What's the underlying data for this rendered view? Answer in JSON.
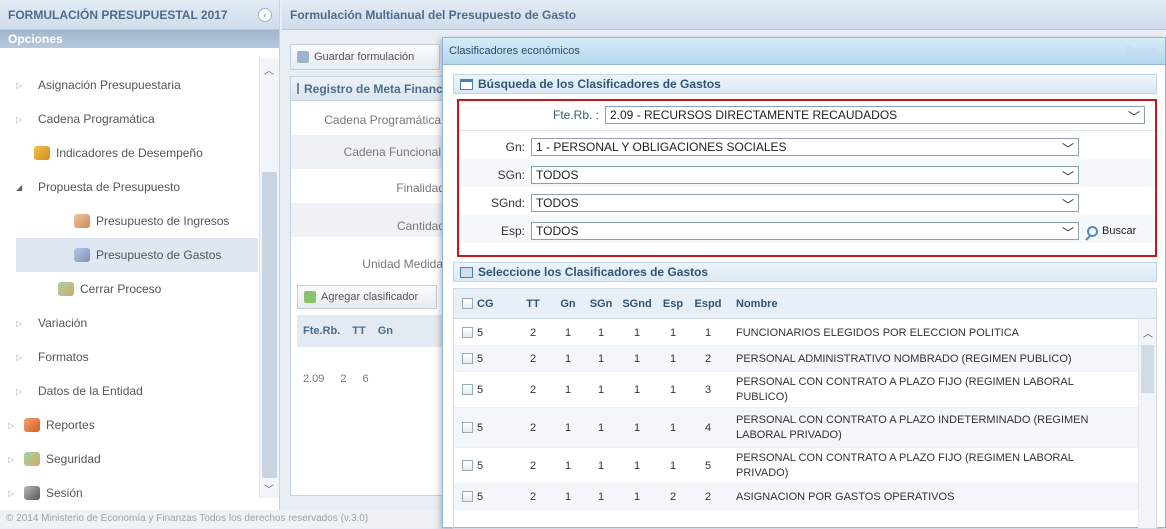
{
  "left_panel": {
    "title": "FORMULACIÓN PRESUPUESTAL 2017",
    "collapse_glyph": "‹",
    "opciones": "Opciones",
    "menu": [
      {
        "label": "Asignación Presupuestaria",
        "kind": "child"
      },
      {
        "label": "Cadena Programática",
        "kind": "child"
      },
      {
        "label": "Indicadores de Desempeño",
        "kind": "child-icon",
        "icon": "indicator-icon"
      },
      {
        "label": "Propuesta de Presupuesto",
        "kind": "child-open"
      },
      {
        "label": "Presupuesto de Ingresos",
        "kind": "sub",
        "icon": "income-icon"
      },
      {
        "label": "Presupuesto de Gastos",
        "kind": "sub",
        "icon": "expense-icon",
        "selected": true
      },
      {
        "label": "Cerrar Proceso",
        "kind": "child-icon",
        "icon": "close-process-icon"
      },
      {
        "label": "Variación",
        "kind": "child"
      },
      {
        "label": "Formatos",
        "kind": "child"
      },
      {
        "label": "Datos de la Entidad",
        "kind": "child"
      },
      {
        "label": "Reportes",
        "kind": "root",
        "icon": "reports-icon"
      },
      {
        "label": "Seguridad",
        "kind": "root",
        "icon": "security-icon"
      },
      {
        "label": "Sesión",
        "kind": "root",
        "icon": "session-icon"
      }
    ],
    "footer": "© 2014 Ministerio de Economía y Finanzas Todos los derechos reservados (v.3.0)"
  },
  "main": {
    "title": "Formulación Multianual del Presupuesto de Gasto",
    "save_button": "Guardar formulación",
    "meta_panel_title": "Registro de Meta Financiera",
    "meta_rows": [
      "Cadena Programática",
      "Cadena Funcional",
      "Finalidad",
      "Cantidad",
      "Unidad Medida"
    ],
    "add_button": "Agregar clasificador",
    "mini_grid_headers": [
      "Fte.Rb.",
      "TT",
      "Gn"
    ],
    "mini_grid_row": [
      "2.09",
      "2",
      "6"
    ]
  },
  "modal": {
    "title": "Clasificadores económicos",
    "title_right_ghost": "Buscar",
    "search_section_title": "Búsqueda de los Clasificadores de Gastos",
    "filters": {
      "fterb_label": "Fte.Rb. :",
      "fterb_value": "2.09 - RECURSOS DIRECTAMENTE RECAUDADOS",
      "gn_label": "Gn:",
      "gn_value": "1 - PERSONAL Y OBLIGACIONES SOCIALES",
      "sgn_label": "SGn:",
      "sgn_value": "TODOS",
      "sgnd_label": "SGnd:",
      "sgnd_value": "TODOS",
      "esp_label": "Esp:",
      "esp_value": "TODOS"
    },
    "search_button": "Buscar",
    "grid_section_title": "Seleccione los Clasificadores de Gastos",
    "grid_headers": {
      "cg": "CG",
      "tt": "TT",
      "gn": "Gn",
      "sgn": "SGn",
      "sgnd": "SGnd",
      "esp": "Esp",
      "espd": "Espd",
      "nombre": "Nombre"
    },
    "rows": [
      {
        "cg": "5",
        "tt": "2",
        "gn": "1",
        "sgn": "1",
        "sgnd": "1",
        "esp": "1",
        "espd": "1",
        "nombre": "FUNCIONARIOS ELEGIDOS POR ELECCION POLITICA"
      },
      {
        "cg": "5",
        "tt": "2",
        "gn": "1",
        "sgn": "1",
        "sgnd": "1",
        "esp": "1",
        "espd": "2",
        "nombre": "PERSONAL ADMINISTRATIVO NOMBRADO (REGIMEN PUBLICO)"
      },
      {
        "cg": "5",
        "tt": "2",
        "gn": "1",
        "sgn": "1",
        "sgnd": "1",
        "esp": "1",
        "espd": "3",
        "nombre": "PERSONAL CON CONTRATO A PLAZO FIJO (REGIMEN LABORAL PUBLICO)"
      },
      {
        "cg": "5",
        "tt": "2",
        "gn": "1",
        "sgn": "1",
        "sgnd": "1",
        "esp": "1",
        "espd": "4",
        "nombre": "PERSONAL CON CONTRATO A PLAZO INDETERMINADO (REGIMEN LABORAL PRIVADO)"
      },
      {
        "cg": "5",
        "tt": "2",
        "gn": "1",
        "sgn": "1",
        "sgnd": "1",
        "esp": "1",
        "espd": "5",
        "nombre": "PERSONAL CON CONTRATO A PLAZO FIJO (REGIMEN LABORAL PRIVADO)"
      },
      {
        "cg": "5",
        "tt": "2",
        "gn": "1",
        "sgn": "1",
        "sgnd": "1",
        "esp": "2",
        "espd": "2",
        "nombre": "ASIGNACION POR GASTOS OPERATIVOS"
      }
    ]
  }
}
